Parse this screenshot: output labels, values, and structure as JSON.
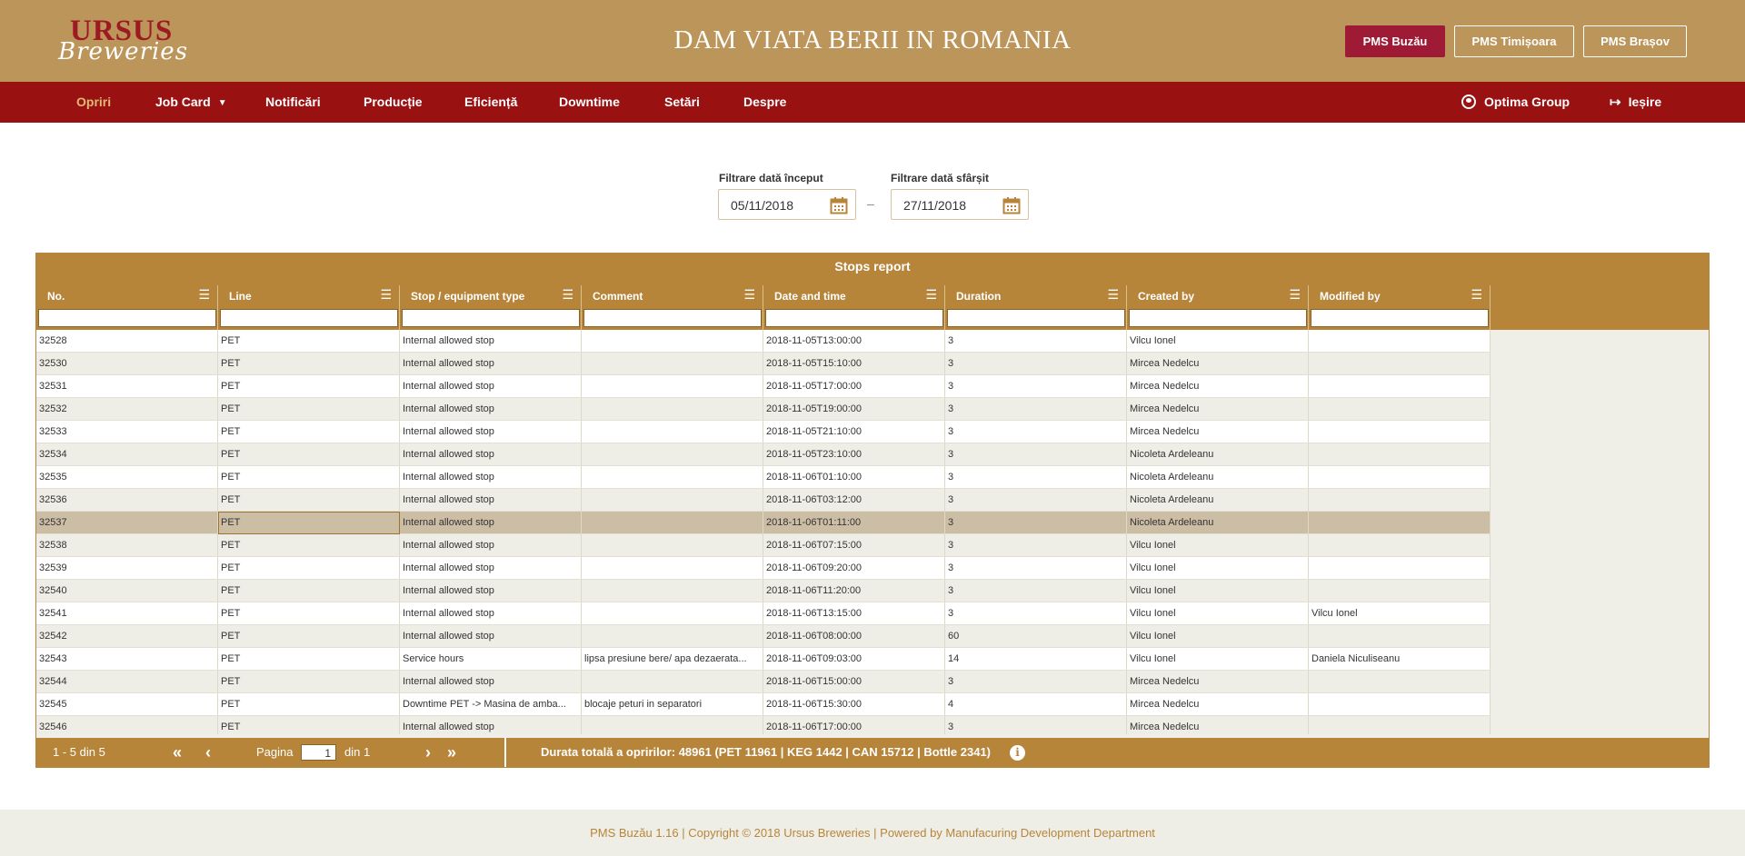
{
  "header": {
    "logo_top": "URSUS",
    "logo_bottom": "Breweries",
    "slogan": "DAM VIATA BERII IN ROMANIA",
    "sites": [
      {
        "label": "PMS Buzău",
        "active": true
      },
      {
        "label": "PMS Timișoara",
        "active": false
      },
      {
        "label": "PMS Brașov",
        "active": false
      }
    ]
  },
  "nav": {
    "items": [
      {
        "label": "Opriri",
        "active": true
      },
      {
        "label": "Job Card",
        "dropdown": true
      },
      {
        "label": "Notificări"
      },
      {
        "label": "Producție"
      },
      {
        "label": "Eficiență"
      },
      {
        "label": "Downtime"
      },
      {
        "label": "Setări"
      },
      {
        "label": "Despre"
      }
    ],
    "user": "Optima Group",
    "logout": "Ieșire"
  },
  "filters": {
    "start_label": "Filtrare dată început",
    "start_value": "05/11/2018",
    "separator": "–",
    "end_label": "Filtrare dată sfârșit",
    "end_value": "27/11/2018"
  },
  "grid": {
    "title": "Stops report",
    "columns": [
      "No.",
      "Line",
      "Stop / equipment type",
      "Comment",
      "Date and time",
      "Duration",
      "Created by",
      "Modified by"
    ],
    "rows": [
      [
        "32528",
        "PET",
        "Internal allowed stop",
        "",
        "2018-11-05T13:00:00",
        "3",
        "Vilcu Ionel",
        ""
      ],
      [
        "32530",
        "PET",
        "Internal allowed stop",
        "",
        "2018-11-05T15:10:00",
        "3",
        "Mircea Nedelcu",
        ""
      ],
      [
        "32531",
        "PET",
        "Internal allowed stop",
        "",
        "2018-11-05T17:00:00",
        "3",
        "Mircea Nedelcu",
        ""
      ],
      [
        "32532",
        "PET",
        "Internal allowed stop",
        "",
        "2018-11-05T19:00:00",
        "3",
        "Mircea Nedelcu",
        ""
      ],
      [
        "32533",
        "PET",
        "Internal allowed stop",
        "",
        "2018-11-05T21:10:00",
        "3",
        "Mircea Nedelcu",
        ""
      ],
      [
        "32534",
        "PET",
        "Internal allowed stop",
        "",
        "2018-11-05T23:10:00",
        "3",
        "Nicoleta Ardeleanu",
        ""
      ],
      [
        "32535",
        "PET",
        "Internal allowed stop",
        "",
        "2018-11-06T01:10:00",
        "3",
        "Nicoleta Ardeleanu",
        ""
      ],
      [
        "32536",
        "PET",
        "Internal allowed stop",
        "",
        "2018-11-06T03:12:00",
        "3",
        "Nicoleta Ardeleanu",
        ""
      ],
      [
        "32537",
        "PET",
        "Internal allowed stop",
        "",
        "2018-11-06T01:11:00",
        "3",
        "Nicoleta Ardeleanu",
        ""
      ],
      [
        "32538",
        "PET",
        "Internal allowed stop",
        "",
        "2018-11-06T07:15:00",
        "3",
        "Vilcu Ionel",
        ""
      ],
      [
        "32539",
        "PET",
        "Internal allowed stop",
        "",
        "2018-11-06T09:20:00",
        "3",
        "Vilcu Ionel",
        ""
      ],
      [
        "32540",
        "PET",
        "Internal allowed stop",
        "",
        "2018-11-06T11:20:00",
        "3",
        "Vilcu Ionel",
        ""
      ],
      [
        "32541",
        "PET",
        "Internal allowed stop",
        "",
        "2018-11-06T13:15:00",
        "3",
        "Vilcu Ionel",
        "Vilcu Ionel"
      ],
      [
        "32542",
        "PET",
        "Internal allowed stop",
        "",
        "2018-11-06T08:00:00",
        "60",
        "Vilcu Ionel",
        ""
      ],
      [
        "32543",
        "PET",
        "Service hours",
        "lipsa presiune bere/ apa dezaerata...",
        "2018-11-06T09:03:00",
        "14",
        "Vilcu Ionel",
        "Daniela Niculiseanu"
      ],
      [
        "32544",
        "PET",
        "Internal allowed stop",
        "",
        "2018-11-06T15:00:00",
        "3",
        "Mircea Nedelcu",
        ""
      ],
      [
        "32545",
        "PET",
        "Downtime PET -> Masina de amba...",
        "blocaje peturi in separatori",
        "2018-11-06T15:30:00",
        "4",
        "Mircea Nedelcu",
        ""
      ],
      [
        "32546",
        "PET",
        "Internal allowed stop",
        "",
        "2018-11-06T17:00:00",
        "3",
        "Mircea Nedelcu",
        ""
      ]
    ],
    "selected_row": 8,
    "footer": {
      "range": "1 - 5 din 5",
      "page_label": "Pagina",
      "page_value": "1",
      "page_of": "din 1",
      "total": "Durata totală a opririlor: 48961 (PET 11961 | KEG 1442 | CAN 15712 | Bottle 2341)"
    }
  },
  "footer": {
    "text": "PMS Buzău 1.16  |  Copyright ©  2018 Ursus Breweries   |  Powered by Manufacuring Development Department"
  },
  "colors": {
    "header_gold": "#bb955a",
    "nav_red": "#9a1112",
    "grid_gold": "#b7853a",
    "active_site": "#9e1a35"
  }
}
